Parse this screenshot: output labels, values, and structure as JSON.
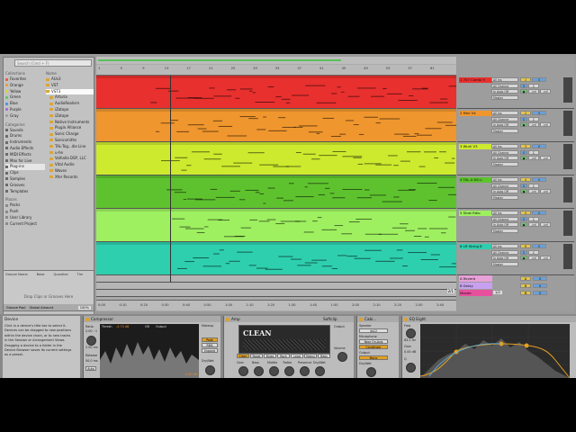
{
  "browser": {
    "search_placeholder": "Search (Cmd + F)",
    "collections_label": "Collections",
    "collections": [
      {
        "label": "Favorites",
        "color": "#e8502e"
      },
      {
        "label": "Orange",
        "color": "#f0962e"
      },
      {
        "label": "Yellow",
        "color": "#e8d02e"
      },
      {
        "label": "Green",
        "color": "#5ec25e"
      },
      {
        "label": "Blue",
        "color": "#3e8ee8"
      },
      {
        "label": "Purple",
        "color": "#a65ed8"
      },
      {
        "label": "Gray",
        "color": "#9a9a9a"
      }
    ],
    "categories_label": "Categories",
    "categories": [
      "Sounds",
      "Drums",
      "Instruments",
      "Audio Effects",
      "MIDI Effects",
      "Max for Live",
      "Plug-ins",
      "Clips",
      "Samples",
      "Grooves",
      "Templates"
    ],
    "places_label": "Places",
    "places": [
      "Packs",
      "Push",
      "User Library",
      "Current Project"
    ],
    "name_header": "Name",
    "items": [
      "AUv3",
      "VST",
      "VST3",
      "Arturia",
      "AudioRealism",
      "iZotope",
      "iZotope",
      "Native Instruments",
      "Plugin Alliance",
      "Sonic Charge",
      "Sonicsmiths",
      "TAL-Tog...die Line",
      "u-he",
      "Valhalla DSP, LLC",
      "Vital Audio",
      "Waves",
      "Xfer Records"
    ]
  },
  "groove_pool": {
    "headers": [
      "Groove Name",
      "Base",
      "Quantize",
      "Tim"
    ],
    "drop_text": "Drop Clips or Grooves Here",
    "footer_label": "Groove Pool",
    "global_label": "Global Amount",
    "global_amount": "100%"
  },
  "ruler": {
    "labels": [
      "1",
      "5",
      "9",
      "13",
      "17",
      "21",
      "25",
      "29",
      "33",
      "37",
      "41",
      "45",
      "49",
      "53",
      "57",
      "61"
    ]
  },
  "timebar": {
    "labels": [
      "0:00",
      "0:10",
      "0:20",
      "0:30",
      "0:40",
      "0:50",
      "1:00",
      "1:10",
      "1:20",
      "1:30",
      "1:40",
      "1:50",
      "2:00",
      "2:10",
      "2:20",
      "2:30",
      "2:40"
    ]
  },
  "zoom_fraction": "2/1",
  "tracks": [
    {
      "name": "1 707 Combi 9",
      "color": "#e8302e",
      "input": "All Ins",
      "channel": "All Channe",
      "monitor": "In Auto Off",
      "output": "Master",
      "volume": "0",
      "pan": "C",
      "send_a": "-inf",
      "send_b": "-inf",
      "track_no": "1"
    },
    {
      "name": "2 Mini V4",
      "color": "#f0962e",
      "input": "All Ins",
      "channel": "All Channe",
      "monitor": "In Auto Off",
      "output": "Master",
      "volume": "0",
      "pan": "C",
      "send_a": "-inf",
      "send_b": "-inf",
      "track_no": "2"
    },
    {
      "name": "3 Wurli V3",
      "color": "#cdea2e",
      "input": "All Ins",
      "channel": "All Channe",
      "monitor": "In Auto Off",
      "output": "Master",
      "volume": "0",
      "pan": "C",
      "send_a": "-inf",
      "send_b": "-inf",
      "track_no": "3"
    },
    {
      "name": "4 TAL-U-NO-L",
      "color": "#5ec22e",
      "input": "All Ins",
      "channel": "All Channe",
      "monitor": "In Auto Off",
      "output": "Master",
      "volume": "0",
      "pan": "C",
      "send_a": "-inf",
      "send_b": "-inf",
      "track_no": "4"
    },
    {
      "name": "5 Strat Rdio",
      "color": "#9ef060",
      "input": "All Ins",
      "channel": "All Channe",
      "monitor": "In Auto Off",
      "output": "Master",
      "volume": "0",
      "pan": "C",
      "send_a": "-inf",
      "send_b": "-inf",
      "track_no": "5"
    },
    {
      "name": "6 LR String 8",
      "color": "#2ecfae",
      "input": "All Ins",
      "channel": "All Channe",
      "monitor": "In Auto Off",
      "output": "Master",
      "volume": "0",
      "pan": "C",
      "send_a": "-inf",
      "send_b": "-inf",
      "track_no": "6"
    }
  ],
  "returns": [
    {
      "name": "A Reverb",
      "color": "#e8a0d8",
      "letter": "A"
    },
    {
      "name": "B Delay",
      "color": "#c8a0f0",
      "letter": "B"
    },
    {
      "name": "Master",
      "color": "#e8509e",
      "letter": "M"
    }
  ],
  "master_fraction": "1/2",
  "info": {
    "title": "Device",
    "lines": [
      "Click in a device's title bar to select it.",
      "Devices can be dragged to new positions",
      "within the device chain, or to new tracks",
      "in the Session or Arrangement Views.",
      "Dragging a device to a folder in the",
      "Device Browser saves its current settings",
      "as a preset."
    ]
  },
  "compressor": {
    "title": "Compressor",
    "thresh_label": "Thresh",
    "thresh_value": "-4.73 dB",
    "gr_label": "GR",
    "output_label": "Output",
    "ratio_label": "Ratio",
    "ratio_value": "2.00 : 1",
    "attack_label": "Attack",
    "attack_value": "2.00 ms",
    "release_label": "Release",
    "release_value": "50.0 ms",
    "auto_label": "Auto",
    "makeup_label": "Makeup",
    "peak_label": "Peak",
    "rms_label": "RMS",
    "expand_label": "Expand",
    "out_value": "0.00 dB",
    "dry_wet_label": "Dry/Wet"
  },
  "amp": {
    "title": "Amp",
    "model": "CLEAN",
    "knobs": [
      "Gain",
      "Bass",
      "Middle",
      "Treble",
      "Presence",
      "Dry/Wet"
    ],
    "output_label": "Output",
    "volume_label": "Volume",
    "types": [
      "Clean",
      "Boost",
      "Blues",
      "Rock",
      "Lead",
      "Heavy",
      "Bass"
    ],
    "softclip_label": "Softclip"
  },
  "cabinet": {
    "title": "Cabi...",
    "speaker_label": "Speaker",
    "speaker_value": "4x12",
    "mic_label": "Microphone",
    "mic_value": "Near On-Axis",
    "mic_type": "Condenser",
    "output_label": "Output",
    "output_value": "Mono",
    "dry_wet_label": "Dry/Wet"
  },
  "eq": {
    "title": "EQ Eight",
    "freq_label": "Freq",
    "freq_value": "83.2 Hz",
    "gain_label": "Gain",
    "gain_value": "0.00 dB",
    "q_label": "Q",
    "q_value": "0.71",
    "band_label": "1",
    "scale_label": "Scale"
  }
}
